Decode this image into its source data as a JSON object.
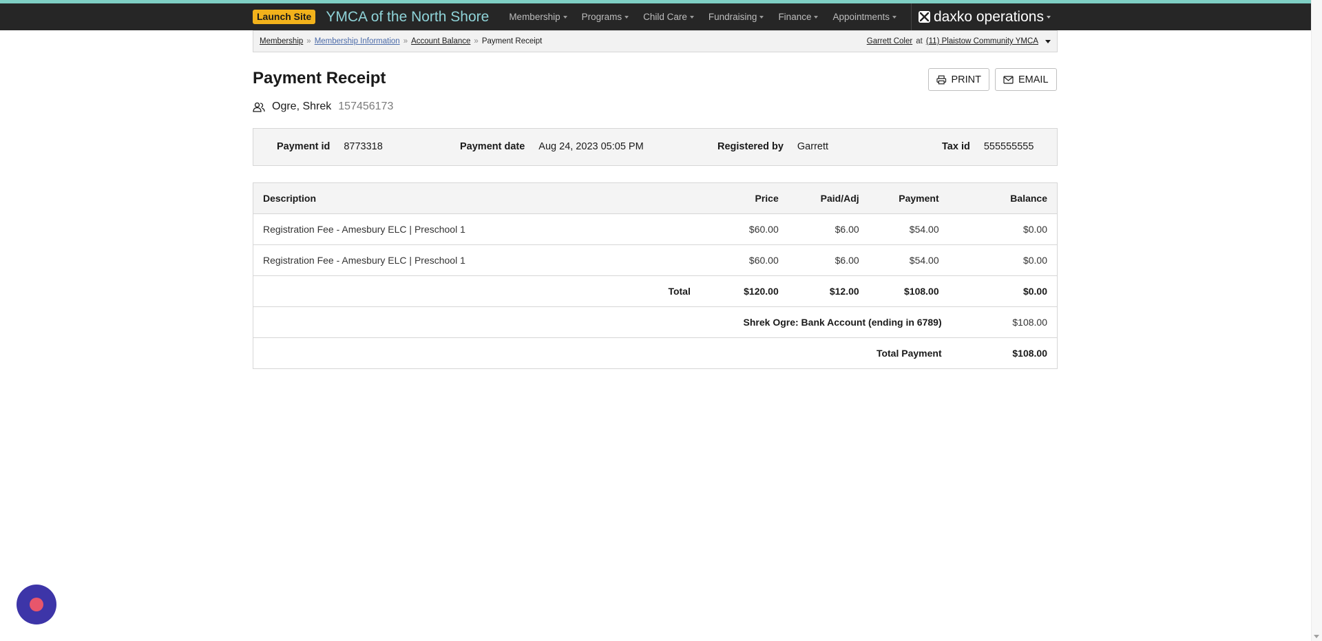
{
  "topnav": {
    "launch_label": "Launch Site",
    "org_title": "YMCA of the North Shore",
    "menu": [
      {
        "label": "Membership"
      },
      {
        "label": "Programs"
      },
      {
        "label": "Child Care"
      },
      {
        "label": "Fundraising"
      },
      {
        "label": "Finance"
      },
      {
        "label": "Appointments"
      }
    ],
    "brand": "daxko operations"
  },
  "breadcrumb": {
    "items": [
      {
        "label": "Membership"
      },
      {
        "label": "Membership Information"
      },
      {
        "label": "Account Balance"
      }
    ],
    "current": "Payment Receipt",
    "separator": "»",
    "user": "Garrett Coler",
    "at": "at",
    "location": "(11) Plaistow Community YMCA"
  },
  "page": {
    "title": "Payment Receipt",
    "print_label": "PRINT",
    "email_label": "EMAIL"
  },
  "member": {
    "name": "Ogre, Shrek",
    "id": "157456173"
  },
  "info": {
    "payment_id_label": "Payment id",
    "payment_id": "8773318",
    "payment_date_label": "Payment date",
    "payment_date": "Aug 24, 2023 05:05 PM",
    "registered_by_label": "Registered by",
    "registered_by": "Garrett",
    "tax_id_label": "Tax id",
    "tax_id": "555555555"
  },
  "table": {
    "headers": {
      "description": "Description",
      "price": "Price",
      "paid_adj": "Paid/Adj",
      "payment": "Payment",
      "balance": "Balance"
    },
    "rows": [
      {
        "description": "Registration Fee - Amesbury ELC | Preschool 1",
        "price": "$60.00",
        "paid_adj": "$6.00",
        "payment": "$54.00",
        "balance": "$0.00"
      },
      {
        "description": "Registration Fee - Amesbury ELC | Preschool 1",
        "price": "$60.00",
        "paid_adj": "$6.00",
        "payment": "$54.00",
        "balance": "$0.00"
      }
    ],
    "total": {
      "label": "Total",
      "price": "$120.00",
      "paid_adj": "$12.00",
      "payment": "$108.00",
      "balance": "$0.00"
    },
    "tender": {
      "label": "Shrek Ogre: Bank Account (ending in 6789)",
      "amount": "$108.00"
    },
    "total_payment": {
      "label": "Total Payment",
      "amount": "$108.00"
    }
  },
  "icons": {
    "member": "users-icon",
    "print": "printer-icon",
    "email": "envelope-icon",
    "brand": "daxko-logo-icon",
    "chat": "chat-launcher-icon"
  },
  "colors": {
    "accent_bar": "#7fcfc4",
    "nav_background": "#262626",
    "launch_button": "#f2b21b",
    "org_title": "#8fd3d8",
    "chat_bubble": "#3d35a8",
    "chat_dot": "#e8566b"
  }
}
